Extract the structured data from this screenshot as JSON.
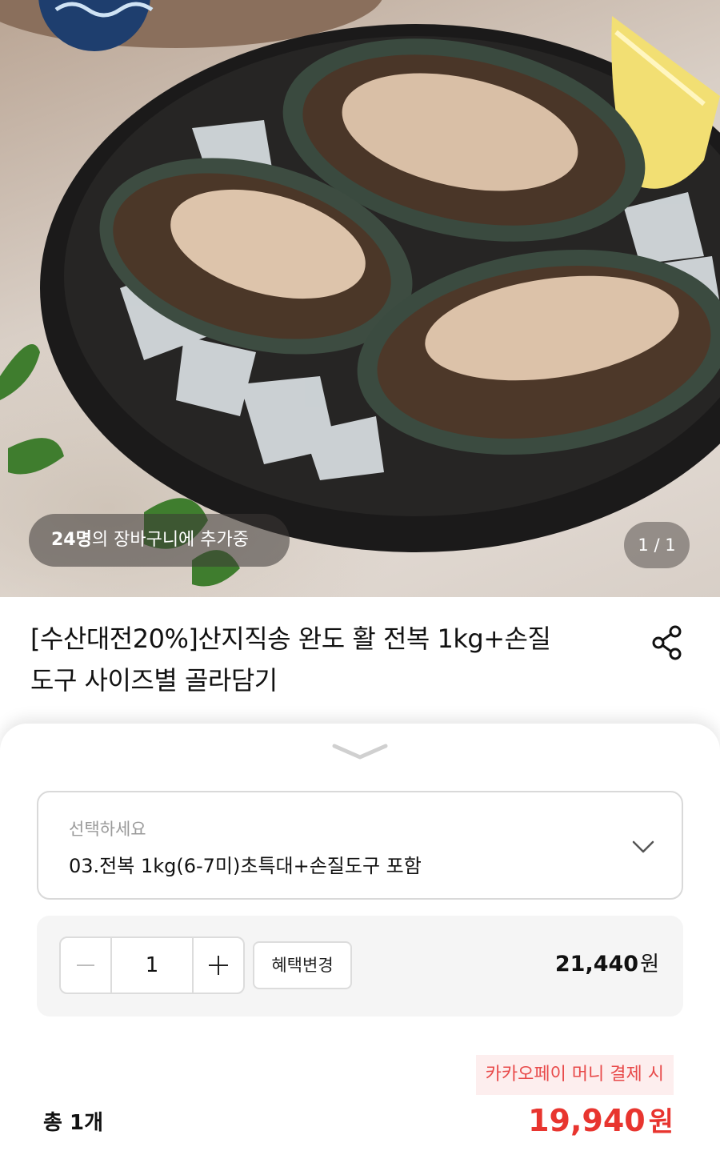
{
  "hero": {
    "cart_count": "24명",
    "cart_text": "의 장바구니에 추가중",
    "page_indicator": "1 / 1"
  },
  "product": {
    "title_line1": "[수산대전20%]산지직송 완도 활 전복 1kg+손질",
    "title_line2": "도구 사이즈별 골라담기",
    "share_icon": "share-icon"
  },
  "sheet": {
    "option_placeholder": "선택하세요",
    "option_selected": "03.전복 1kg(6-7미)초특대+손질도구 포함",
    "quantity": "1",
    "minus_label": "−",
    "plus_label": "+",
    "benefit_button": "혜택변경",
    "line_price": "21,440",
    "currency": "원",
    "kakao_note": "카카오페이 머니 결제 시",
    "total_count": "총 1개",
    "total_price": "19,940",
    "total_currency": "원"
  },
  "colors": {
    "accent_red": "#e8352f",
    "badge_bg": "#fdeeee"
  }
}
